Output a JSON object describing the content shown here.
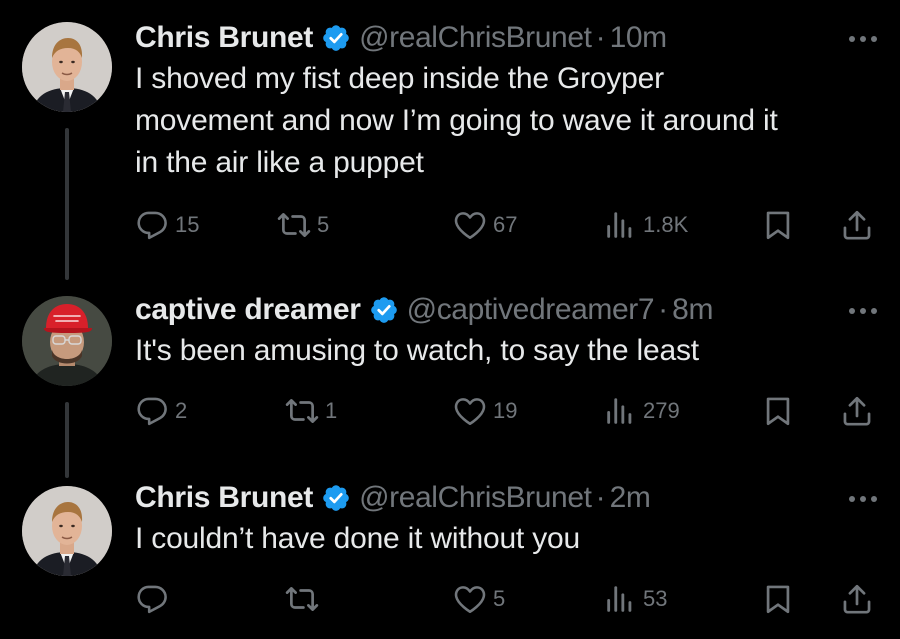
{
  "colors": {
    "background": "#000000",
    "primary_text": "#e7e9ea",
    "secondary_text": "#71767b",
    "verified_blue": "#1d9bf0",
    "thread_line": "#333639"
  },
  "tweets": [
    {
      "name": "Chris Brunet",
      "handle": "@realChrisBrunet",
      "separator": "·",
      "time": "10m",
      "verified": true,
      "avatar": "avatar-man-suit",
      "text_lines": [
        "I shoved my fist deep inside the Groyper",
        "movement and now I’m going to wave it around it",
        "in the air like a puppet"
      ],
      "stats": {
        "replies": "15",
        "reposts": "5",
        "likes": "67",
        "views": "1.8K"
      }
    },
    {
      "name": "captive dreamer",
      "handle": "@captivedreamer7",
      "separator": "·",
      "time": "8m",
      "verified": true,
      "avatar": "avatar-red-cap",
      "avatar_cap_text": "MAKE AMERICA GREAT AGAIN",
      "text_lines": [
        "It's been amusing to watch, to say the least"
      ],
      "stats": {
        "replies": "2",
        "reposts": "1",
        "likes": "19",
        "views": "279"
      }
    },
    {
      "name": "Chris Brunet",
      "handle": "@realChrisBrunet",
      "separator": "·",
      "time": "2m",
      "verified": true,
      "avatar": "avatar-man-suit",
      "text_lines": [
        "I couldn’t have done it without you"
      ],
      "stats": {
        "replies": "",
        "reposts": "",
        "likes": "5",
        "views": "53"
      }
    }
  ],
  "icons": {
    "reply": "reply-icon",
    "repost": "repost-icon",
    "like": "like-icon",
    "views": "views-icon",
    "bookmark": "bookmark-icon",
    "share": "share-icon",
    "more": "more-icon",
    "verified": "verified-badge-icon"
  }
}
